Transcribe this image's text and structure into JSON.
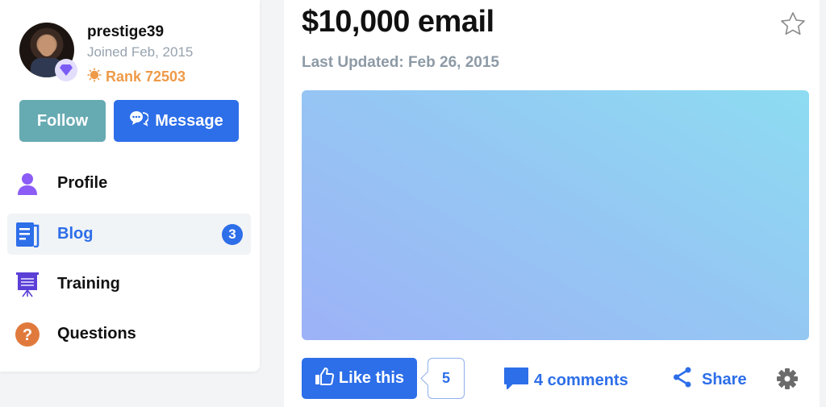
{
  "profile": {
    "username": "prestige39",
    "joined": "Joined Feb, 2015",
    "rank": "Rank 72503",
    "avatar_icon": "user-photo",
    "badge_icon": "gem-icon"
  },
  "actions": {
    "follow_label": "Follow",
    "message_label": "Message"
  },
  "nav": {
    "items": [
      {
        "label": "Profile",
        "icon": "user-icon"
      },
      {
        "label": "Blog",
        "icon": "blog-icon",
        "badge": "3",
        "active": true
      },
      {
        "label": "Training",
        "icon": "presentation-icon"
      },
      {
        "label": "Questions",
        "icon": "question-icon"
      }
    ]
  },
  "post": {
    "title": "$10,000 email",
    "last_updated": "Last Updated: Feb 26, 2015",
    "like_label": "Like this",
    "like_count": "5",
    "comments_label": "4 comments",
    "share_label": "Share"
  },
  "colors": {
    "accent": "#2d6ee9",
    "follow": "#66aab2",
    "rank": "#ee9a48",
    "muted": "#8d9aa6"
  }
}
